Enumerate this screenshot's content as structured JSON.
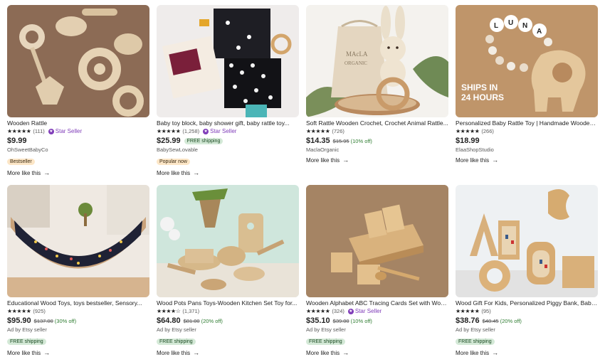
{
  "more_like_this_label": "More like this",
  "arrow_glyph": "→",
  "star_glyph": "★★★★★",
  "star_glyph_4half": "★★★★☆",
  "star_seller_label": "Star Seller",
  "free_shipping_label": "FREE shipping",
  "listings": [
    {
      "title": "Wooden Rattle",
      "rating_count": "(111)",
      "star_seller": true,
      "price": "$9.99",
      "shop": "OhSweetBabyCo",
      "tag": "Bestseller"
    },
    {
      "title": "Baby toy block, baby shower gift, baby rattle toy...",
      "rating_count": "(1,258)",
      "star_seller": true,
      "price": "$25.99",
      "free_shipping_inline": true,
      "shop": "BabySewLovable",
      "tag": "Popular now"
    },
    {
      "title": "Soft Rattle Wooden Crochet, Crochet Animal Rattle...",
      "rating_count": "(726)",
      "price": "$14.35",
      "original_price": "$15.95",
      "discount": "(10% off)",
      "shop": "MaclaOrganic"
    },
    {
      "title": "Personalized Baby Rattle Toy | Handmade Wooden...",
      "rating_count": "(266)",
      "price": "$18.99",
      "shop": "ElaaShopStudio"
    },
    {
      "title": "Educational Wood Toys, toys bestseller, Sensory...",
      "rating_count": "(925)",
      "price": "$95.90",
      "original_price": "$137.00",
      "discount": "(30% off)",
      "shop": "Ad by Etsy seller",
      "tag": "FREE shipping"
    },
    {
      "title": "Wood Pots Pans Toys-Wooden Kitchen Set Toy for...",
      "rating_count": "(1,371)",
      "half": true,
      "price": "$64.80",
      "original_price": "$81.00",
      "discount": "(20% off)",
      "shop": "Ad by Etsy seller",
      "tag": "FREE shipping"
    },
    {
      "title": "Wooden Alphabet ABC Tracing Cards Set with Wooden...",
      "rating_count": "(324)",
      "star_seller": true,
      "price": "$35.10",
      "original_price": "$39.00",
      "discount": "(10% off)",
      "shop": "Ad by Etsy seller",
      "tag": "FREE shipping"
    },
    {
      "title": "Wood Gift For Kids, Personalized Piggy Bank, Baby...",
      "rating_count": "(95)",
      "price": "$38.76",
      "original_price": "$48.45",
      "discount": "(20% off)",
      "shop": "Ad by Etsy seller",
      "tag": "FREE shipping"
    }
  ],
  "image_text": {
    "ships_line1": "SHIPS IN",
    "ships_line2": "24 HOURS",
    "bead_letters": [
      "L",
      "U",
      "N",
      "A"
    ],
    "bag_text1": "MAcLA",
    "bag_text2": "ORGANIC"
  },
  "colors": {
    "star_seller": "#7f3cb8",
    "free_pill": "#d4e9d7",
    "bestseller_pill": "#fce6c7"
  }
}
